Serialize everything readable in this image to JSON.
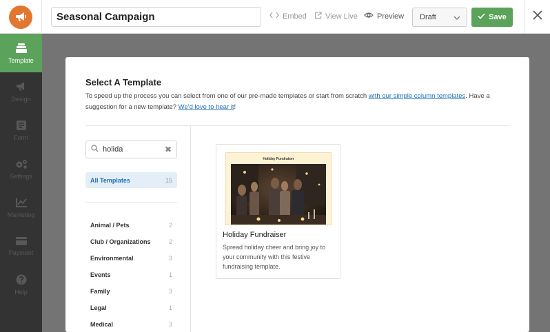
{
  "topbar": {
    "campaign_name": "Seasonal Campaign",
    "embed_label": "Embed",
    "view_live_label": "View Live",
    "preview_label": "Preview",
    "status_value": "Draft",
    "save_label": "Save"
  },
  "sidebar": {
    "items": [
      {
        "label": "Template",
        "icon": "template-icon",
        "active": true
      },
      {
        "label": "Design",
        "icon": "megaphone-icon"
      },
      {
        "label": "Form",
        "icon": "form-icon"
      },
      {
        "label": "Settings",
        "icon": "gears-icon"
      },
      {
        "label": "Marketing",
        "icon": "chart-icon"
      },
      {
        "label": "Payment",
        "icon": "credit-card-icon"
      },
      {
        "label": "Help",
        "icon": "help-icon"
      }
    ]
  },
  "modal": {
    "title": "Select A Template",
    "desc_text_1": "To speed up the process you can select from one of our pre-made templates or start from scratch ",
    "desc_link_1": "with our simple column templates",
    "desc_text_2": ". Have a suggestion for a new template? ",
    "desc_link_2": "We'd love to hear it",
    "desc_text_3": "!"
  },
  "search": {
    "value": "holida"
  },
  "all_templates": {
    "label": "All Templates",
    "count": "15"
  },
  "categories": [
    {
      "label": "Animal / Pets",
      "count": "2"
    },
    {
      "label": "Club / Organizations",
      "count": "2"
    },
    {
      "label": "Environmental",
      "count": "3"
    },
    {
      "label": "Events",
      "count": "1"
    },
    {
      "label": "Family",
      "count": "3"
    },
    {
      "label": "Legal",
      "count": "1"
    },
    {
      "label": "Medical",
      "count": "3"
    }
  ],
  "template_card": {
    "thumbnail_title": "Holiday Fundraiser",
    "title": "Holiday Fundraiser",
    "description": "Spread holiday cheer and bring joy to your community with this festive fundraising template."
  },
  "colors": {
    "accent_green": "#5ba35a",
    "logo_orange": "#e27730",
    "link_blue": "#1f6fb6"
  }
}
